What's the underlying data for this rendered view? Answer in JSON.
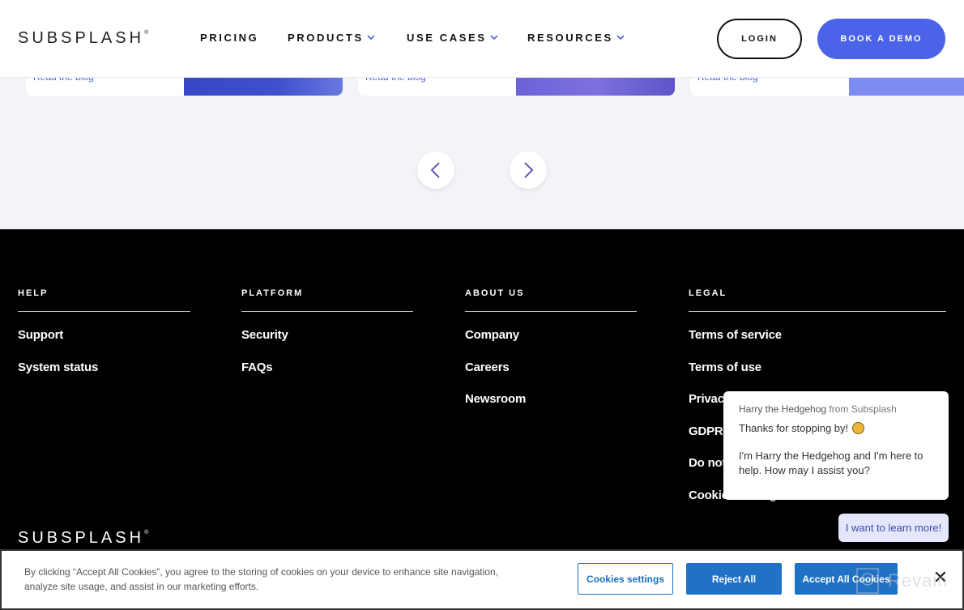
{
  "header": {
    "logo": "SUBSPLASH",
    "logo_mark": "®",
    "nav": [
      {
        "label": "PRICING",
        "has_dropdown": false
      },
      {
        "label": "PRODUCTS",
        "has_dropdown": true
      },
      {
        "label": "USE CASES",
        "has_dropdown": true
      },
      {
        "label": "RESOURCES",
        "has_dropdown": true
      }
    ],
    "login_label": "LOGIN",
    "demo_label": "BOOK A DEMO"
  },
  "blog": {
    "cards": [
      {
        "link": "Read the blog"
      },
      {
        "link": "Read the blog"
      },
      {
        "link": "Read the blog"
      }
    ],
    "prev_icon": "chevron-left-icon",
    "next_icon": "chevron-right-icon"
  },
  "footer": {
    "columns": [
      {
        "title": "HELP",
        "links": [
          "Support",
          "System status"
        ]
      },
      {
        "title": "PLATFORM",
        "links": [
          "Security",
          "FAQs"
        ]
      },
      {
        "title": "ABOUT US",
        "links": [
          "Company",
          "Careers",
          "Newsroom"
        ]
      },
      {
        "title": "LEGAL",
        "links": [
          "Terms of service",
          "Terms of use",
          "Privacy",
          "GDPR",
          "Do not sell",
          "Cookies settings"
        ]
      }
    ],
    "logo": "SUBSPLASH",
    "logo_mark": "®"
  },
  "chat": {
    "sender_name": "Harry the Hedgehog",
    "sender_from": "from Subsplash",
    "line1": "Thanks for stopping by!",
    "line2": "I'm Harry the Hedgehog and I'm here to help. How may I assist you?",
    "reply_label": "I want to learn more!"
  },
  "cookie_banner": {
    "text": "By clicking “Accept All Cookies”, you agree to the storing of cookies on your device to enhance site navigation, analyze site usage, and assist in our marketing efforts.",
    "settings_label": "Cookies settings",
    "reject_label": "Reject All",
    "accept_label": "Accept All Cookies",
    "close_glyph": "✕"
  },
  "watermark": "Revain",
  "colors": {
    "brand_blue": "#4a63e8",
    "cookie_blue": "#1f72c6",
    "footer_bg": "#000000",
    "chevron_purple": "#5b3fb0"
  }
}
